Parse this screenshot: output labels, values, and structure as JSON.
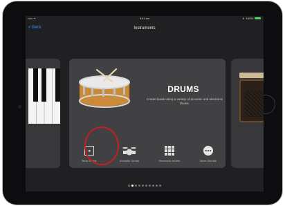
{
  "status": {
    "carrier": "••••• ᯤ",
    "time": "9:41 am",
    "battery": "100%"
  },
  "nav": {
    "back_label": "< Back",
    "title": "Instruments"
  },
  "featured": {
    "title": "DRUMS",
    "description": "Create beats using a variety of acoustic and electronic drums."
  },
  "kits": [
    {
      "label": "Beat Drums",
      "icon": "beat-sequencer-icon"
    },
    {
      "label": "Acoustic Drums",
      "icon": "drum-kit-icon"
    },
    {
      "label": "Electronic Drums",
      "icon": "drum-pad-grid-icon"
    },
    {
      "label": "More Sounds",
      "icon": "more-icon"
    }
  ],
  "pages": {
    "count": 10,
    "current": 2
  },
  "colors": {
    "accent": "#3d8bff",
    "annotation": "#c91e1e",
    "battery": "#4cd964"
  }
}
